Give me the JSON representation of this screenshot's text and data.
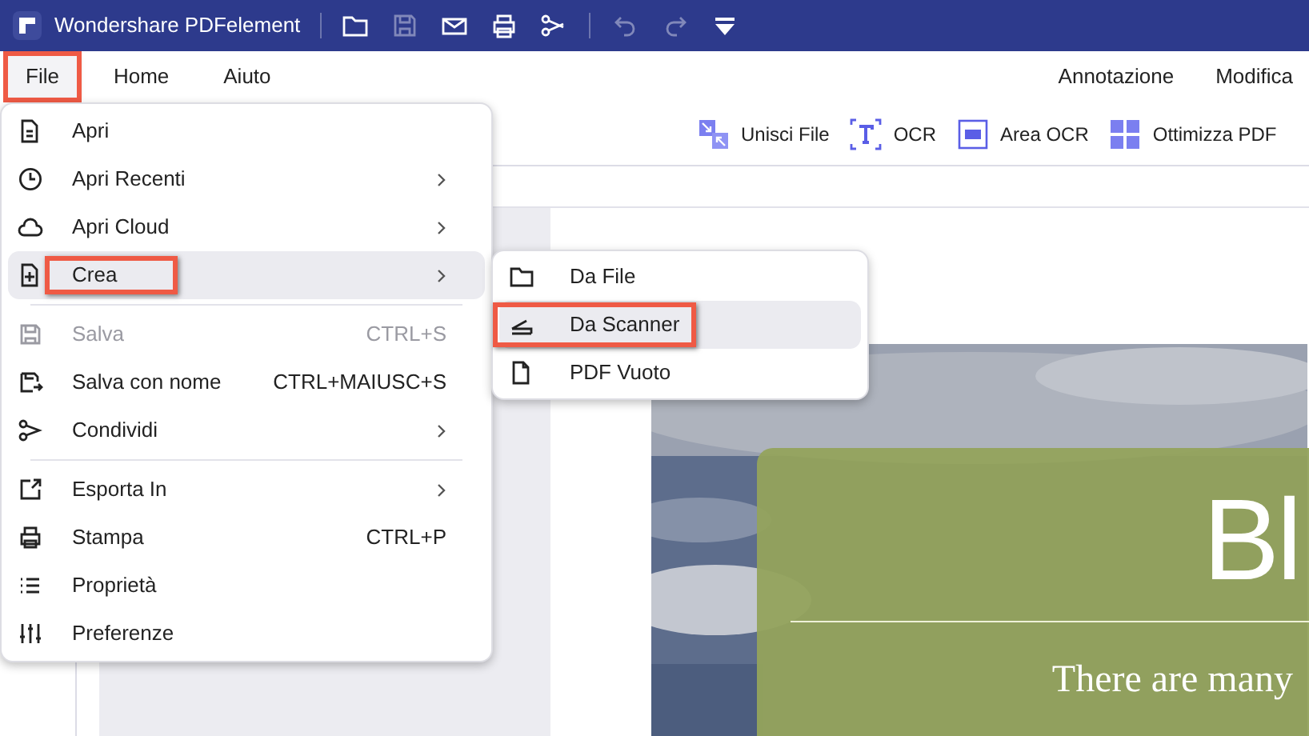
{
  "window": {
    "title": "Wondershare PDFelement"
  },
  "quick_actions": [
    {
      "disabled": false
    },
    {
      "disabled": true
    },
    {
      "disabled": false
    },
    {
      "disabled": false
    },
    {
      "disabled": false
    },
    {
      "disabled": true
    },
    {
      "disabled": true
    },
    {
      "disabled": false
    }
  ],
  "menu_bar": {
    "left": [
      {
        "label": "File",
        "selected": true,
        "marked": true
      },
      {
        "label": "Home",
        "selected": false,
        "marked": false
      },
      {
        "label": "Aiuto",
        "selected": false,
        "marked": false
      }
    ],
    "right": [
      {
        "label": "Annotazione"
      },
      {
        "label": "Modifica"
      }
    ]
  },
  "toolbar": [
    {
      "label": "Unisci File"
    },
    {
      "label": "OCR"
    },
    {
      "label": "Area OCR"
    },
    {
      "label": "Ottimizza PDF"
    }
  ],
  "file_menu": {
    "groups": [
      [
        {
          "label": "Apri",
          "submenu": false,
          "disabled": false,
          "selected": false,
          "marked": false
        },
        {
          "label": "Apri Recenti",
          "submenu": true,
          "disabled": false,
          "selected": false,
          "marked": false
        },
        {
          "label": "Apri Cloud",
          "submenu": true,
          "disabled": false,
          "selected": false,
          "marked": false
        },
        {
          "label": "Crea",
          "submenu": true,
          "disabled": false,
          "selected": true,
          "marked": true
        }
      ],
      [
        {
          "label": "Salva",
          "shortcut": "CTRL+S",
          "submenu": false,
          "disabled": true,
          "selected": false,
          "marked": false
        },
        {
          "label": "Salva con nome",
          "shortcut": "CTRL+MAIUSC+S",
          "submenu": false,
          "disabled": false,
          "selected": false,
          "marked": false
        },
        {
          "label": "Condividi",
          "submenu": true,
          "disabled": false,
          "selected": false,
          "marked": false
        }
      ],
      [
        {
          "label": "Esporta In",
          "submenu": true,
          "disabled": false,
          "selected": false,
          "marked": false
        },
        {
          "label": "Stampa",
          "shortcut": "CTRL+P",
          "submenu": false,
          "disabled": false,
          "selected": false,
          "marked": false
        },
        {
          "label": "Proprietà",
          "submenu": false,
          "disabled": false,
          "selected": false,
          "marked": false
        },
        {
          "label": "Preferenze",
          "submenu": false,
          "disabled": false,
          "selected": false,
          "marked": false
        }
      ]
    ]
  },
  "create_submenu": [
    {
      "label": "Da File",
      "selected": false,
      "marked": false
    },
    {
      "label": "Da Scanner",
      "selected": true,
      "marked": true
    },
    {
      "label": "PDF Vuoto",
      "selected": false,
      "marked": false
    }
  ],
  "document": {
    "heading": "Bl",
    "subtitle": "There are many"
  }
}
